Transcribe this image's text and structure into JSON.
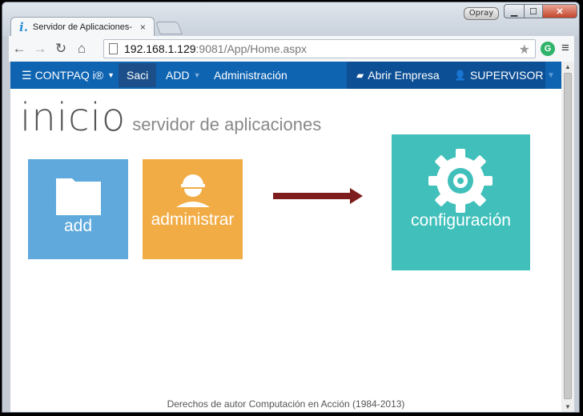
{
  "browser": {
    "tab_title": "Servidor de Aplicaciones-",
    "tab_close": "×",
    "user_badge": "Opray",
    "url_host": "192.168.1.129",
    "url_rest": ":9081/App/Home.aspx",
    "ext_label": "G"
  },
  "navbar": {
    "brand": "CONTPAQ i®",
    "saci": "Saci",
    "add": "ADD",
    "admin": "Administración",
    "abrir_empresa": "Abrir Empresa",
    "supervisor": "SUPERVISOR"
  },
  "heading": {
    "title": "inicio",
    "subtitle": "servidor de aplicaciones"
  },
  "tiles": [
    {
      "label": "add",
      "color": "#5fa9dc"
    },
    {
      "label": "administrar",
      "color": "#f2ac45"
    },
    {
      "label": "configuración",
      "color": "#41c0bb"
    }
  ],
  "arrow_color": "#7d1d1d",
  "navbar_color": "#0f64b2",
  "footer": "Derechos de autor Computación en Acción (1984-2013)"
}
